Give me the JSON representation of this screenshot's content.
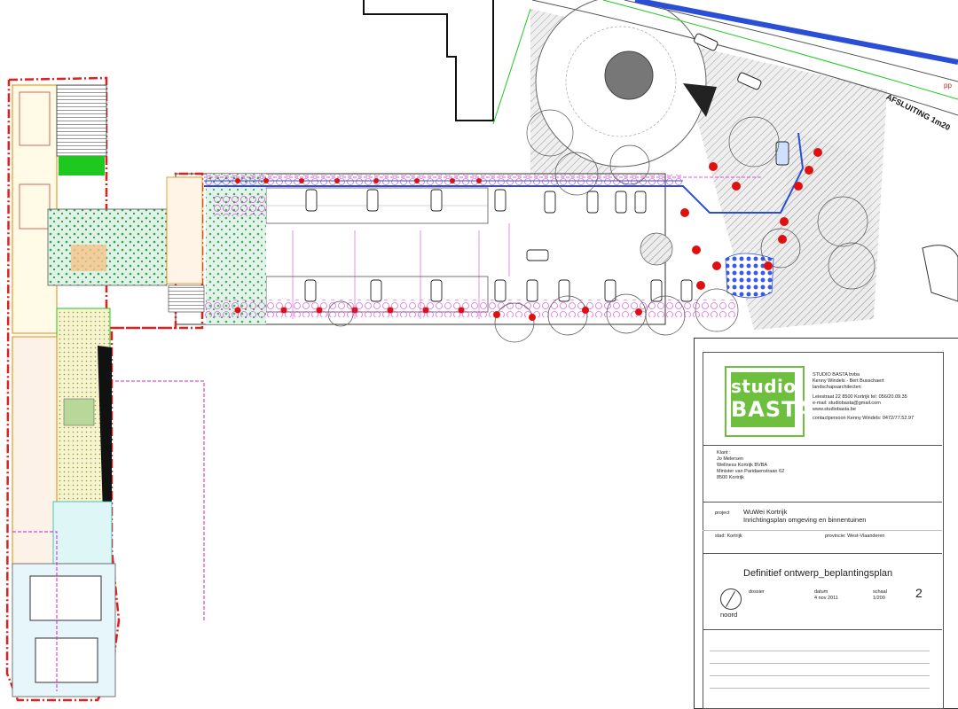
{
  "drawing": {
    "road_label": "AFSLUITING 1m20",
    "top_right_label": "pp"
  },
  "title_block": {
    "logo_line1": "studio",
    "logo_line2": "BASTA",
    "firm_name": "STUDIO BASTA bvba",
    "firm_people": "Kenny Windels - Bert Busschaert",
    "firm_type": "landschapsarchitecten",
    "address": "Leiestraat 22 8500 Kortrijk tel: 056/20.09.35",
    "email": "e-mail: studiobasta@gmail.com",
    "web": "www.studiobasta.be",
    "contact": "contactpersoon Kenny Windels: 0472/77.52.97",
    "client_label": "Klant :",
    "client_name": "Jo Melersen",
    "client_company": "Wellness Kortrijk BVBA",
    "client_street": "Minister van Paridaenstraan 62",
    "client_city": "8500 Kortrijk",
    "project_label": "project",
    "project_name": "WuWei Kortrijk",
    "project_desc": "Inrichtingsplan omgeving en binnentuinen",
    "city_label": "stad: Kortrijk",
    "province_label": "provincie: West-Vlaanderen",
    "plan_title": "Definitief ontwerp_beplantingsplan",
    "dossier_label": "dossier",
    "date_label": "datum",
    "date_value": "4 nov 2011",
    "scale_label": "schaal",
    "scale_value": "1/200",
    "sheet_number": "2",
    "north_label": "noord"
  },
  "colors": {
    "logo_green": "#6ebf3e",
    "parking_blue": "#2a4fd6",
    "tree_red": "#e01010",
    "plant_magenta": "#d21fd2",
    "lawn_green": "#1fc81f",
    "hatch_grey": "#8a8a8a"
  }
}
